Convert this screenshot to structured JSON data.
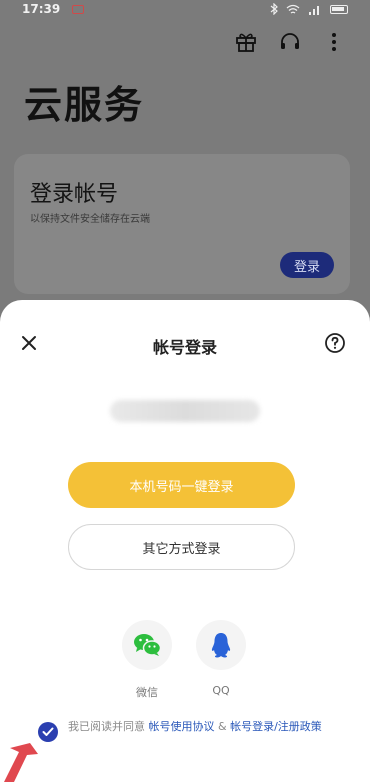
{
  "status": {
    "time": "17:39"
  },
  "background": {
    "title": "云服务",
    "card": {
      "title": "登录帐号",
      "subtitle": "以保持文件安全储存在云端",
      "button": "登录"
    }
  },
  "sheet": {
    "title": "帐号登录",
    "primary_button": "本机号码一键登录",
    "secondary_button": "其它方式登录",
    "social": [
      {
        "label": "微信",
        "icon": "wechat-icon"
      },
      {
        "label": "QQ",
        "icon": "qq-icon"
      }
    ],
    "agreement": {
      "prefix": "我已阅读并同意 ",
      "link1": "帐号使用协议",
      "sep": " & ",
      "link2": "帐号登录/注册政策"
    }
  },
  "colors": {
    "primary": "#f4c137",
    "accent": "#2b3fb0",
    "link": "#2a58b9"
  }
}
